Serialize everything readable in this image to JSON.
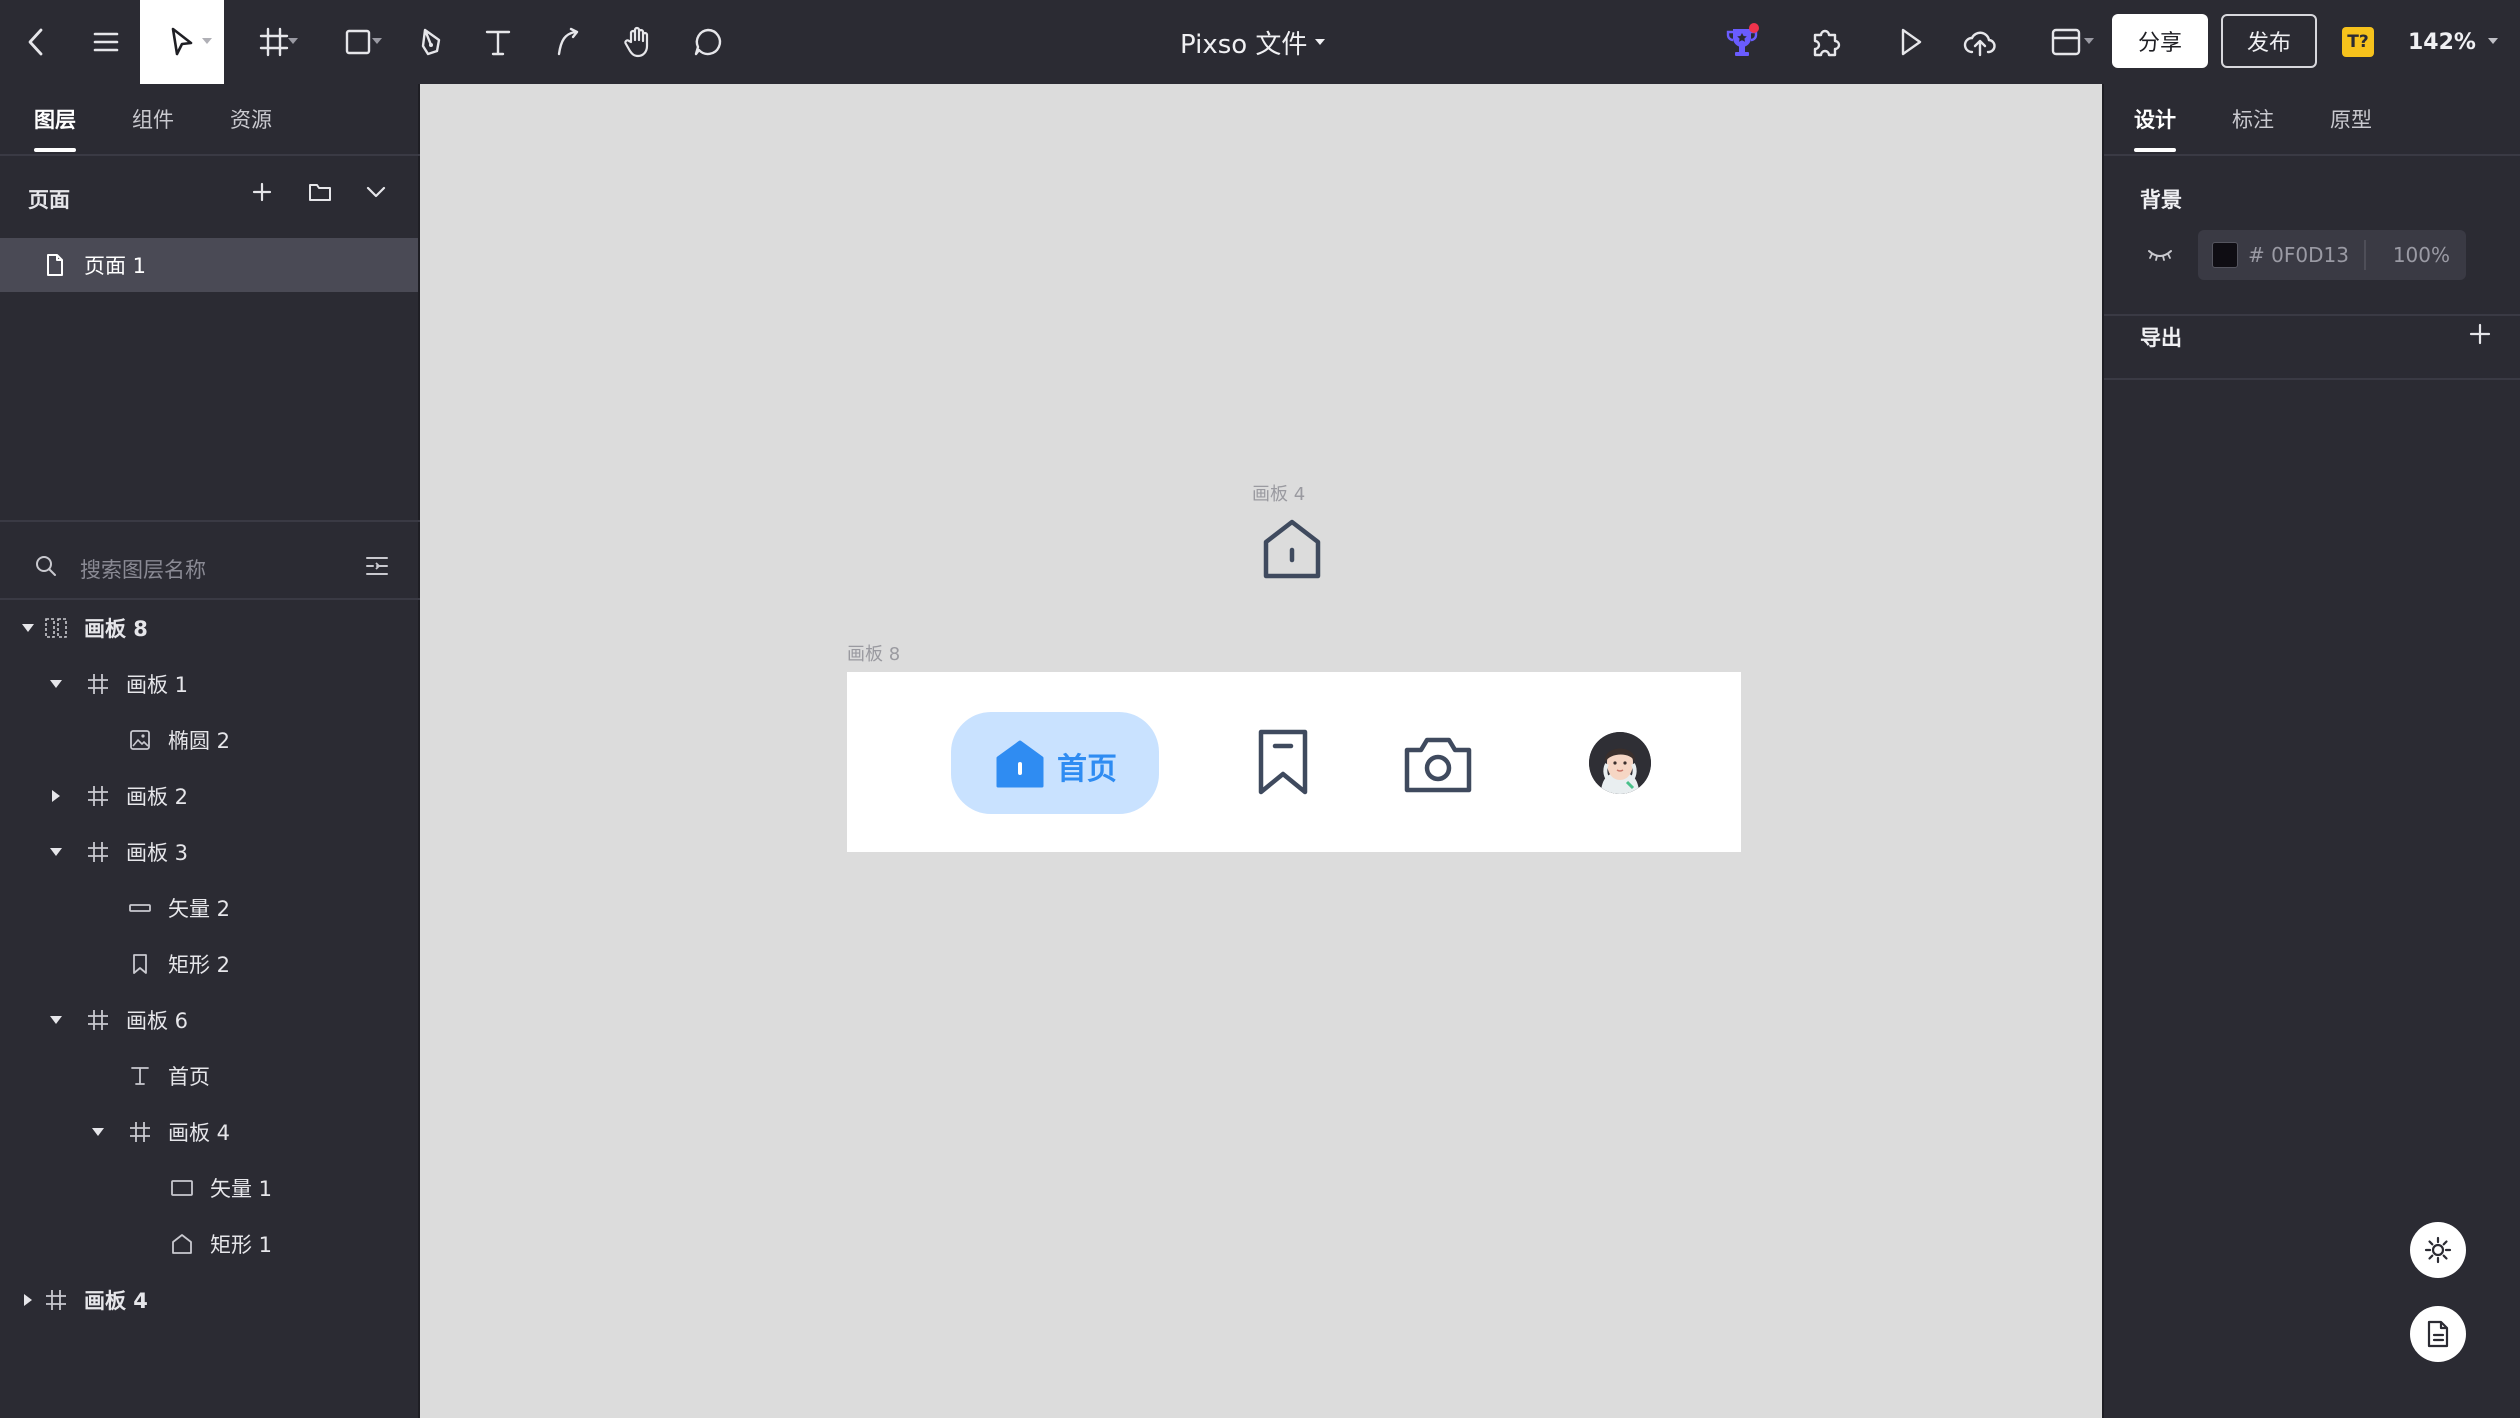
{
  "toolbar": {
    "title": "Pixso 文件",
    "share_label": "分享",
    "publish_label": "发布",
    "plugin_badge": "T?",
    "zoom": "142%"
  },
  "left_panel": {
    "tabs": [
      "图层",
      "组件",
      "资源"
    ],
    "pages_heading": "页面",
    "pages": [
      "页面 1"
    ],
    "search_placeholder": "搜索图层名称",
    "layers": [
      {
        "name": "画板 8"
      },
      {
        "name": "画板 1"
      },
      {
        "name": "椭圆 2"
      },
      {
        "name": "画板 2"
      },
      {
        "name": "画板 3"
      },
      {
        "name": "矢量 2"
      },
      {
        "name": "矩形 2"
      },
      {
        "name": "画板 6"
      },
      {
        "name": "首页"
      },
      {
        "name": "画板 4"
      },
      {
        "name": "矢量 1"
      },
      {
        "name": "矩形 1"
      },
      {
        "name": "画板 4"
      }
    ]
  },
  "canvas": {
    "frame4_label": "画板 4",
    "frame8_label": "画板 8",
    "home_label": "首页"
  },
  "right_panel": {
    "tabs": [
      "设计",
      "标注",
      "原型"
    ],
    "background_heading": "背景",
    "hex": "# 0F0D13",
    "opacity": "100%",
    "export_heading": "导出"
  },
  "colors": {
    "toolbar_bg": "#2b2b33",
    "canvas_bg": "#dcdcdc",
    "accent_blue": "#2f8cf2",
    "pill_bg": "#c9e2ff",
    "background_swatch": "#0f0d13"
  }
}
